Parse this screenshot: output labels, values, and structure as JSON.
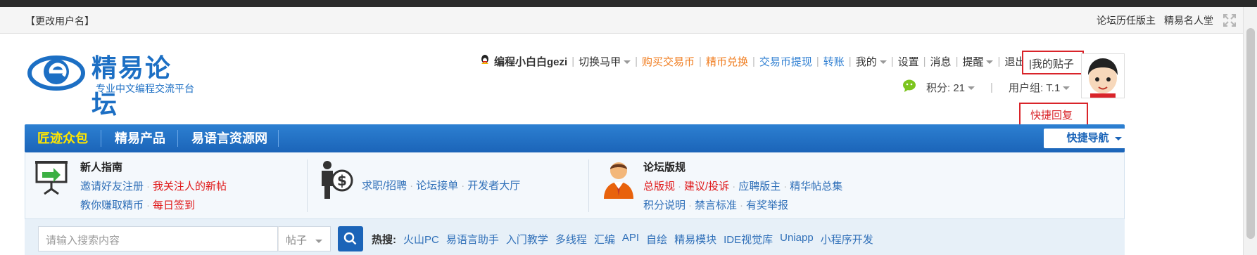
{
  "userbar": {
    "change_name": "【更改用户名】",
    "links": [
      "论坛历任版主",
      "精易名人堂"
    ]
  },
  "logo": {
    "title": "精易论坛",
    "subtitle": "专业中文编程交流平台"
  },
  "usernav": {
    "username": "编程小白白gezi",
    "switch": "切换马甲",
    "buy_coin": "购买交易币",
    "exchange": "精币兑换",
    "withdraw": "交易币提现",
    "transfer": "转账",
    "mine": "我的",
    "settings": "设置",
    "messages": "消息",
    "remind": "提醒",
    "logout": "退出",
    "my_posts": "|我的贴子",
    "quick_reply": "快捷回复"
  },
  "stats": {
    "points": "积分: 21",
    "group": "用户组: T.1"
  },
  "navbar": {
    "items": [
      "匠迹众包",
      "精易产品",
      "易语言资源网"
    ],
    "quicknav": "快捷导航"
  },
  "info": {
    "col1": {
      "title": "新人指南",
      "row1": [
        "邀请好友注册",
        "我关注人的新帖"
      ],
      "row2": [
        "教你赚取精币",
        "每日签到"
      ]
    },
    "col2": {
      "links": [
        "求职/招聘",
        "论坛接单",
        "开发者大厅"
      ]
    },
    "col3": {
      "title": "论坛版规",
      "row1": [
        "总版规",
        "建议/投诉",
        "应聘版主",
        "精华帖总集"
      ],
      "row2": [
        "积分说明",
        "禁言标准",
        "有奖举报"
      ]
    }
  },
  "search": {
    "placeholder": "请输入搜索内容",
    "type": "帖子",
    "hot_label": "热搜:",
    "hot": [
      "火山PC",
      "易语言助手",
      "入门教学",
      "多线程",
      "汇编",
      "API",
      "自绘",
      "精易模块",
      "IDE视觉库",
      "Uniapp",
      "小程序开发"
    ]
  },
  "colors": {
    "brand_blue": "#1b64b8",
    "highlight_red": "#d9242a",
    "accent_orange": "#f07c1e",
    "nav_yellow": "#ffe600"
  }
}
